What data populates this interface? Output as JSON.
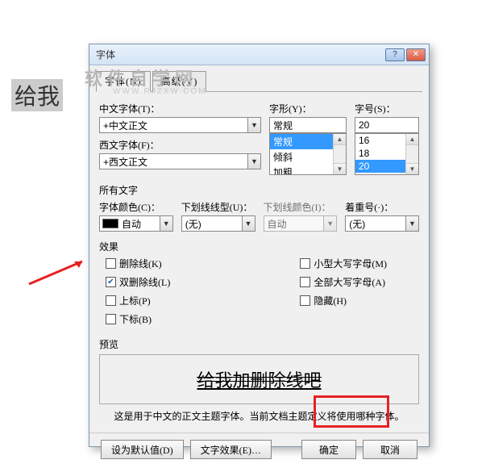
{
  "bg_text": "给我",
  "watermark": "软件自学网",
  "watermark_sub": "WWW.RJZXW.COM",
  "dialog_title": "字体",
  "tabs": {
    "font": "字体(N)",
    "advanced": "高级(V)"
  },
  "labels": {
    "cn_font": "中文字体(T)：",
    "west_font": "西文字体(F)：",
    "style": "字形(Y)：",
    "size": "字号(S)：",
    "all_text": "所有文字",
    "font_color": "字体颜色(C)：",
    "underline_style": "下划线线型(U)：",
    "underline_color": "下划线颜色(I)：",
    "emphasis": "着重号(·)：",
    "effects": "效果",
    "preview": "预览"
  },
  "values": {
    "cn_font": "+中文正文",
    "west_font": "+西文正文",
    "style_input": "常规",
    "size_input": "20",
    "font_color": "自动",
    "underline_style": "(无)",
    "underline_color": "自动",
    "emphasis": "(无)"
  },
  "style_list": [
    "常规",
    "倾斜",
    "加粗"
  ],
  "size_list": [
    "16",
    "18",
    "20"
  ],
  "effects_left": [
    {
      "label": "删除线(K)",
      "checked": false
    },
    {
      "label": "双删除线(L)",
      "checked": true
    },
    {
      "label": "上标(P)",
      "checked": false
    },
    {
      "label": "下标(B)",
      "checked": false
    }
  ],
  "effects_right": [
    {
      "label": "小型大写字母(M)",
      "checked": false
    },
    {
      "label": "全部大写字母(A)",
      "checked": false
    },
    {
      "label": "隐藏(H)",
      "checked": false
    }
  ],
  "preview_text": "给我加删除线吧",
  "note": "这是用于中文的正文主题字体。当前文档主题定义将使用哪种字体。",
  "buttons": {
    "set_default": "设为默认值(D)",
    "text_effects": "文字效果(E)…",
    "ok": "确定",
    "cancel": "取消"
  }
}
